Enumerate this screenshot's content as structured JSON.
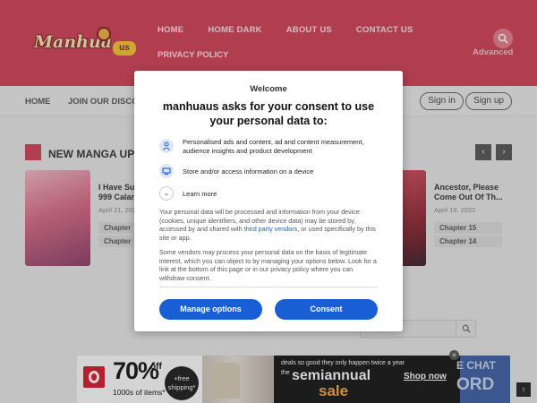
{
  "header": {
    "logo_text": "Manhua",
    "logo_suffix": "us",
    "nav": [
      "HOME",
      "HOME DARK",
      "ABOUT US",
      "CONTACT US"
    ],
    "nav_row2": "PRIVACY POLICY",
    "advanced": "Advanced"
  },
  "navbar": {
    "home": "HOME",
    "join": "JOIN OUR DISCOR",
    "sign_in": "Sign in",
    "sign_up": "Sign up"
  },
  "section": {
    "title": "NEW MANGA UPDA",
    "prev": "‹",
    "next": "›"
  },
  "manga_left": {
    "title_line1": "I Have Su",
    "title_line2": "999 Calar",
    "date": "April 21, 2022",
    "chapters": [
      "Chapter",
      "Chapter"
    ]
  },
  "manga_right": {
    "title_line1": "Ancestor, Please",
    "title_line2": "Come Out Of Th...",
    "date": "April 19, 2022",
    "chapters": [
      "Chapter 15",
      "Chapter 14"
    ]
  },
  "consent": {
    "welcome": "Welcome",
    "heading": "manhuaus asks for your consent to use your personal data to:",
    "purposes": [
      "Personalised ads and content, ad and content measurement, audience insights and product development",
      "Store and/or access information on a device"
    ],
    "learn_more": "Learn more",
    "para1_start": "Your personal data will be processed and information from your device (cookies, unique identifiers, and other device data) may be stored by, accessed by and shared with ",
    "para1_link": "third party vendors",
    "para1_end": ", or used specifically by this site or app.",
    "para2": "Some vendors may process your personal data on the basis of legitimate interest, which you can object to by managing your options below. Look for a link at the bottom of this page or in our privacy policy where you can withdraw consent.",
    "manage_button": "Manage options",
    "consent_button": "Consent"
  },
  "ad": {
    "percent": "70%",
    "off": "off",
    "items": "1000s of items*",
    "badge": "+free shipping*",
    "deals": "deals so good they only happen twice a year",
    "the": "the",
    "semiannual": "semiannual",
    "sale": "sale",
    "shop_now": "Shop now",
    "close": "×"
  },
  "side_ad": {
    "line1": "E CHAT",
    "line2": "ORD"
  },
  "scroll_top": "↑"
}
